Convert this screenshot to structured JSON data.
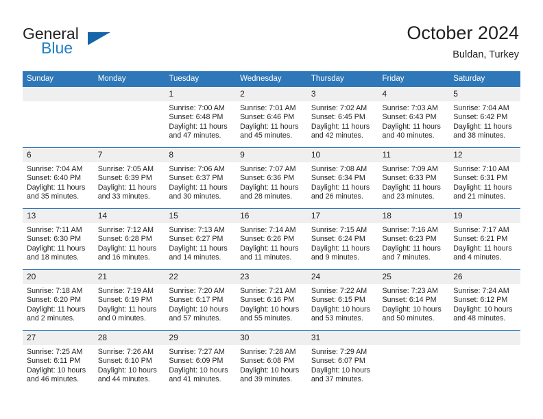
{
  "brand": {
    "name_part1": "General",
    "name_part2": "Blue",
    "triangle_color": "#1565a8",
    "blue_color": "#1f7fc4"
  },
  "header": {
    "title": "October 2024",
    "subtitle": "Buldan, Turkey"
  },
  "theme": {
    "header_bg": "#2e77b8",
    "header_text": "#ffffff",
    "daynum_bg": "#efefef",
    "cell_bg": "#ffffff",
    "row_divider": "#2e77b8",
    "text": "#231f20"
  },
  "weekday_headers": [
    "Sunday",
    "Monday",
    "Tuesday",
    "Wednesday",
    "Thursday",
    "Friday",
    "Saturday"
  ],
  "labels": {
    "sunrise_prefix": "Sunrise:",
    "sunset_prefix": "Sunset:",
    "daylight_prefix": "Daylight:"
  },
  "weeks": [
    [
      {
        "day": "",
        "blank": true,
        "sunrise": "",
        "sunset": "",
        "daylight_line1": "",
        "daylight_line2": ""
      },
      {
        "day": "",
        "blank": true,
        "sunrise": "",
        "sunset": "",
        "daylight_line1": "",
        "daylight_line2": ""
      },
      {
        "day": "1",
        "blank": false,
        "sunrise": "Sunrise: 7:00 AM",
        "sunset": "Sunset: 6:48 PM",
        "daylight_line1": "Daylight: 11 hours",
        "daylight_line2": "and 47 minutes."
      },
      {
        "day": "2",
        "blank": false,
        "sunrise": "Sunrise: 7:01 AM",
        "sunset": "Sunset: 6:46 PM",
        "daylight_line1": "Daylight: 11 hours",
        "daylight_line2": "and 45 minutes."
      },
      {
        "day": "3",
        "blank": false,
        "sunrise": "Sunrise: 7:02 AM",
        "sunset": "Sunset: 6:45 PM",
        "daylight_line1": "Daylight: 11 hours",
        "daylight_line2": "and 42 minutes."
      },
      {
        "day": "4",
        "blank": false,
        "sunrise": "Sunrise: 7:03 AM",
        "sunset": "Sunset: 6:43 PM",
        "daylight_line1": "Daylight: 11 hours",
        "daylight_line2": "and 40 minutes."
      },
      {
        "day": "5",
        "blank": false,
        "sunrise": "Sunrise: 7:04 AM",
        "sunset": "Sunset: 6:42 PM",
        "daylight_line1": "Daylight: 11 hours",
        "daylight_line2": "and 38 minutes."
      }
    ],
    [
      {
        "day": "6",
        "blank": false,
        "sunrise": "Sunrise: 7:04 AM",
        "sunset": "Sunset: 6:40 PM",
        "daylight_line1": "Daylight: 11 hours",
        "daylight_line2": "and 35 minutes."
      },
      {
        "day": "7",
        "blank": false,
        "sunrise": "Sunrise: 7:05 AM",
        "sunset": "Sunset: 6:39 PM",
        "daylight_line1": "Daylight: 11 hours",
        "daylight_line2": "and 33 minutes."
      },
      {
        "day": "8",
        "blank": false,
        "sunrise": "Sunrise: 7:06 AM",
        "sunset": "Sunset: 6:37 PM",
        "daylight_line1": "Daylight: 11 hours",
        "daylight_line2": "and 30 minutes."
      },
      {
        "day": "9",
        "blank": false,
        "sunrise": "Sunrise: 7:07 AM",
        "sunset": "Sunset: 6:36 PM",
        "daylight_line1": "Daylight: 11 hours",
        "daylight_line2": "and 28 minutes."
      },
      {
        "day": "10",
        "blank": false,
        "sunrise": "Sunrise: 7:08 AM",
        "sunset": "Sunset: 6:34 PM",
        "daylight_line1": "Daylight: 11 hours",
        "daylight_line2": "and 26 minutes."
      },
      {
        "day": "11",
        "blank": false,
        "sunrise": "Sunrise: 7:09 AM",
        "sunset": "Sunset: 6:33 PM",
        "daylight_line1": "Daylight: 11 hours",
        "daylight_line2": "and 23 minutes."
      },
      {
        "day": "12",
        "blank": false,
        "sunrise": "Sunrise: 7:10 AM",
        "sunset": "Sunset: 6:31 PM",
        "daylight_line1": "Daylight: 11 hours",
        "daylight_line2": "and 21 minutes."
      }
    ],
    [
      {
        "day": "13",
        "blank": false,
        "sunrise": "Sunrise: 7:11 AM",
        "sunset": "Sunset: 6:30 PM",
        "daylight_line1": "Daylight: 11 hours",
        "daylight_line2": "and 18 minutes."
      },
      {
        "day": "14",
        "blank": false,
        "sunrise": "Sunrise: 7:12 AM",
        "sunset": "Sunset: 6:28 PM",
        "daylight_line1": "Daylight: 11 hours",
        "daylight_line2": "and 16 minutes."
      },
      {
        "day": "15",
        "blank": false,
        "sunrise": "Sunrise: 7:13 AM",
        "sunset": "Sunset: 6:27 PM",
        "daylight_line1": "Daylight: 11 hours",
        "daylight_line2": "and 14 minutes."
      },
      {
        "day": "16",
        "blank": false,
        "sunrise": "Sunrise: 7:14 AM",
        "sunset": "Sunset: 6:26 PM",
        "daylight_line1": "Daylight: 11 hours",
        "daylight_line2": "and 11 minutes."
      },
      {
        "day": "17",
        "blank": false,
        "sunrise": "Sunrise: 7:15 AM",
        "sunset": "Sunset: 6:24 PM",
        "daylight_line1": "Daylight: 11 hours",
        "daylight_line2": "and 9 minutes."
      },
      {
        "day": "18",
        "blank": false,
        "sunrise": "Sunrise: 7:16 AM",
        "sunset": "Sunset: 6:23 PM",
        "daylight_line1": "Daylight: 11 hours",
        "daylight_line2": "and 7 minutes."
      },
      {
        "day": "19",
        "blank": false,
        "sunrise": "Sunrise: 7:17 AM",
        "sunset": "Sunset: 6:21 PM",
        "daylight_line1": "Daylight: 11 hours",
        "daylight_line2": "and 4 minutes."
      }
    ],
    [
      {
        "day": "20",
        "blank": false,
        "sunrise": "Sunrise: 7:18 AM",
        "sunset": "Sunset: 6:20 PM",
        "daylight_line1": "Daylight: 11 hours",
        "daylight_line2": "and 2 minutes."
      },
      {
        "day": "21",
        "blank": false,
        "sunrise": "Sunrise: 7:19 AM",
        "sunset": "Sunset: 6:19 PM",
        "daylight_line1": "Daylight: 11 hours",
        "daylight_line2": "and 0 minutes."
      },
      {
        "day": "22",
        "blank": false,
        "sunrise": "Sunrise: 7:20 AM",
        "sunset": "Sunset: 6:17 PM",
        "daylight_line1": "Daylight: 10 hours",
        "daylight_line2": "and 57 minutes."
      },
      {
        "day": "23",
        "blank": false,
        "sunrise": "Sunrise: 7:21 AM",
        "sunset": "Sunset: 6:16 PM",
        "daylight_line1": "Daylight: 10 hours",
        "daylight_line2": "and 55 minutes."
      },
      {
        "day": "24",
        "blank": false,
        "sunrise": "Sunrise: 7:22 AM",
        "sunset": "Sunset: 6:15 PM",
        "daylight_line1": "Daylight: 10 hours",
        "daylight_line2": "and 53 minutes."
      },
      {
        "day": "25",
        "blank": false,
        "sunrise": "Sunrise: 7:23 AM",
        "sunset": "Sunset: 6:14 PM",
        "daylight_line1": "Daylight: 10 hours",
        "daylight_line2": "and 50 minutes."
      },
      {
        "day": "26",
        "blank": false,
        "sunrise": "Sunrise: 7:24 AM",
        "sunset": "Sunset: 6:12 PM",
        "daylight_line1": "Daylight: 10 hours",
        "daylight_line2": "and 48 minutes."
      }
    ],
    [
      {
        "day": "27",
        "blank": false,
        "sunrise": "Sunrise: 7:25 AM",
        "sunset": "Sunset: 6:11 PM",
        "daylight_line1": "Daylight: 10 hours",
        "daylight_line2": "and 46 minutes."
      },
      {
        "day": "28",
        "blank": false,
        "sunrise": "Sunrise: 7:26 AM",
        "sunset": "Sunset: 6:10 PM",
        "daylight_line1": "Daylight: 10 hours",
        "daylight_line2": "and 44 minutes."
      },
      {
        "day": "29",
        "blank": false,
        "sunrise": "Sunrise: 7:27 AM",
        "sunset": "Sunset: 6:09 PM",
        "daylight_line1": "Daylight: 10 hours",
        "daylight_line2": "and 41 minutes."
      },
      {
        "day": "30",
        "blank": false,
        "sunrise": "Sunrise: 7:28 AM",
        "sunset": "Sunset: 6:08 PM",
        "daylight_line1": "Daylight: 10 hours",
        "daylight_line2": "and 39 minutes."
      },
      {
        "day": "31",
        "blank": false,
        "sunrise": "Sunrise: 7:29 AM",
        "sunset": "Sunset: 6:07 PM",
        "daylight_line1": "Daylight: 10 hours",
        "daylight_line2": "and 37 minutes."
      },
      {
        "day": "",
        "blank": true,
        "sunrise": "",
        "sunset": "",
        "daylight_line1": "",
        "daylight_line2": ""
      },
      {
        "day": "",
        "blank": true,
        "sunrise": "",
        "sunset": "",
        "daylight_line1": "",
        "daylight_line2": ""
      }
    ]
  ]
}
